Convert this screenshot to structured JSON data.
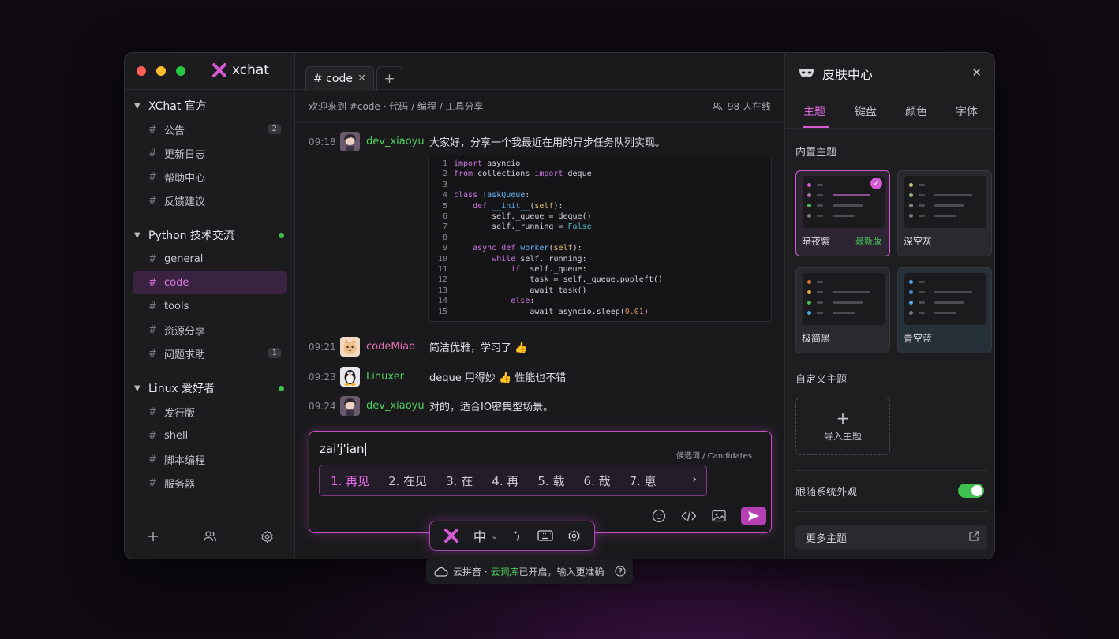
{
  "app": {
    "title": "xchat"
  },
  "sidebar": {
    "groups": [
      {
        "name": "XChat 官方",
        "items": [
          {
            "label": "公告",
            "badge": "2"
          },
          {
            "label": "更新日志"
          },
          {
            "label": "帮助中心"
          },
          {
            "label": "反馈建议"
          }
        ]
      },
      {
        "name": "Python 技术交流",
        "items": [
          {
            "label": "general"
          },
          {
            "label": "code"
          },
          {
            "label": "tools"
          },
          {
            "label": "资源分享"
          },
          {
            "label": "问题求助",
            "badge": "1"
          }
        ]
      },
      {
        "name": "Linux 爱好者",
        "items": [
          {
            "label": "发行版"
          },
          {
            "label": "shell"
          },
          {
            "label": "脚本编程"
          },
          {
            "label": "服务器"
          }
        ]
      }
    ],
    "hash": "#"
  },
  "main": {
    "tab_label": "# code",
    "topic": "欢迎来到 #code · 代码 / 编程 / 工具分享",
    "online": "98 人在线",
    "messages": [
      {
        "time": "09:18",
        "user": "dev_xiaoyu",
        "text": "大家好，分享一个我最近在用的异步任务队列实现。",
        "color": "#4fcf5c"
      },
      {
        "time": "09:21",
        "user": "codeMiao",
        "text": "简洁优雅，学习了 👍",
        "color": "#e26fb0"
      },
      {
        "time": "09:23",
        "user": "Linuxer",
        "text": "deque 用得妙 👍 性能也不错",
        "color": "#4fcf5c"
      },
      {
        "time": "09:24",
        "user": "dev_xiaoyu",
        "text": "对的，适合IO密集型场景。",
        "color": "#4fcf5c"
      }
    ],
    "code_lines": [
      "1",
      "2",
      "3",
      "4",
      "5",
      "6",
      "7",
      "8",
      "9",
      "10",
      "11",
      "12",
      "13",
      "14",
      "15"
    ]
  },
  "composer": {
    "input": "zai'j'ian",
    "candidates_label": "候选词 / Candidates",
    "candidates": [
      "1. 再见",
      "2. 在见",
      "3. 在",
      "4. 再",
      "5. 载",
      "6. 哉",
      "7. 崽"
    ]
  },
  "ime": {
    "mode": "中",
    "cloud_pre": "云拼音 · ",
    "cloud_link": "云词库",
    "cloud_post": "已开启，输入更准确"
  },
  "panel": {
    "title": "皮肤中心",
    "tabs": [
      "主题",
      "键盘",
      "颜色",
      "字体"
    ],
    "builtin_label": "内置主题",
    "themes": [
      {
        "name": "暗夜紫",
        "badge": "最新版"
      },
      {
        "name": "深空灰"
      },
      {
        "name": "极简黑"
      },
      {
        "name": "青空蓝"
      }
    ],
    "custom_label": "自定义主题",
    "import_label": "导入主题",
    "follow_label": "跟随系统外观",
    "follow_on": true,
    "more_label": "更多主题"
  },
  "colors": {
    "accent": "#d35ad3",
    "green": "#3fbf4f"
  }
}
